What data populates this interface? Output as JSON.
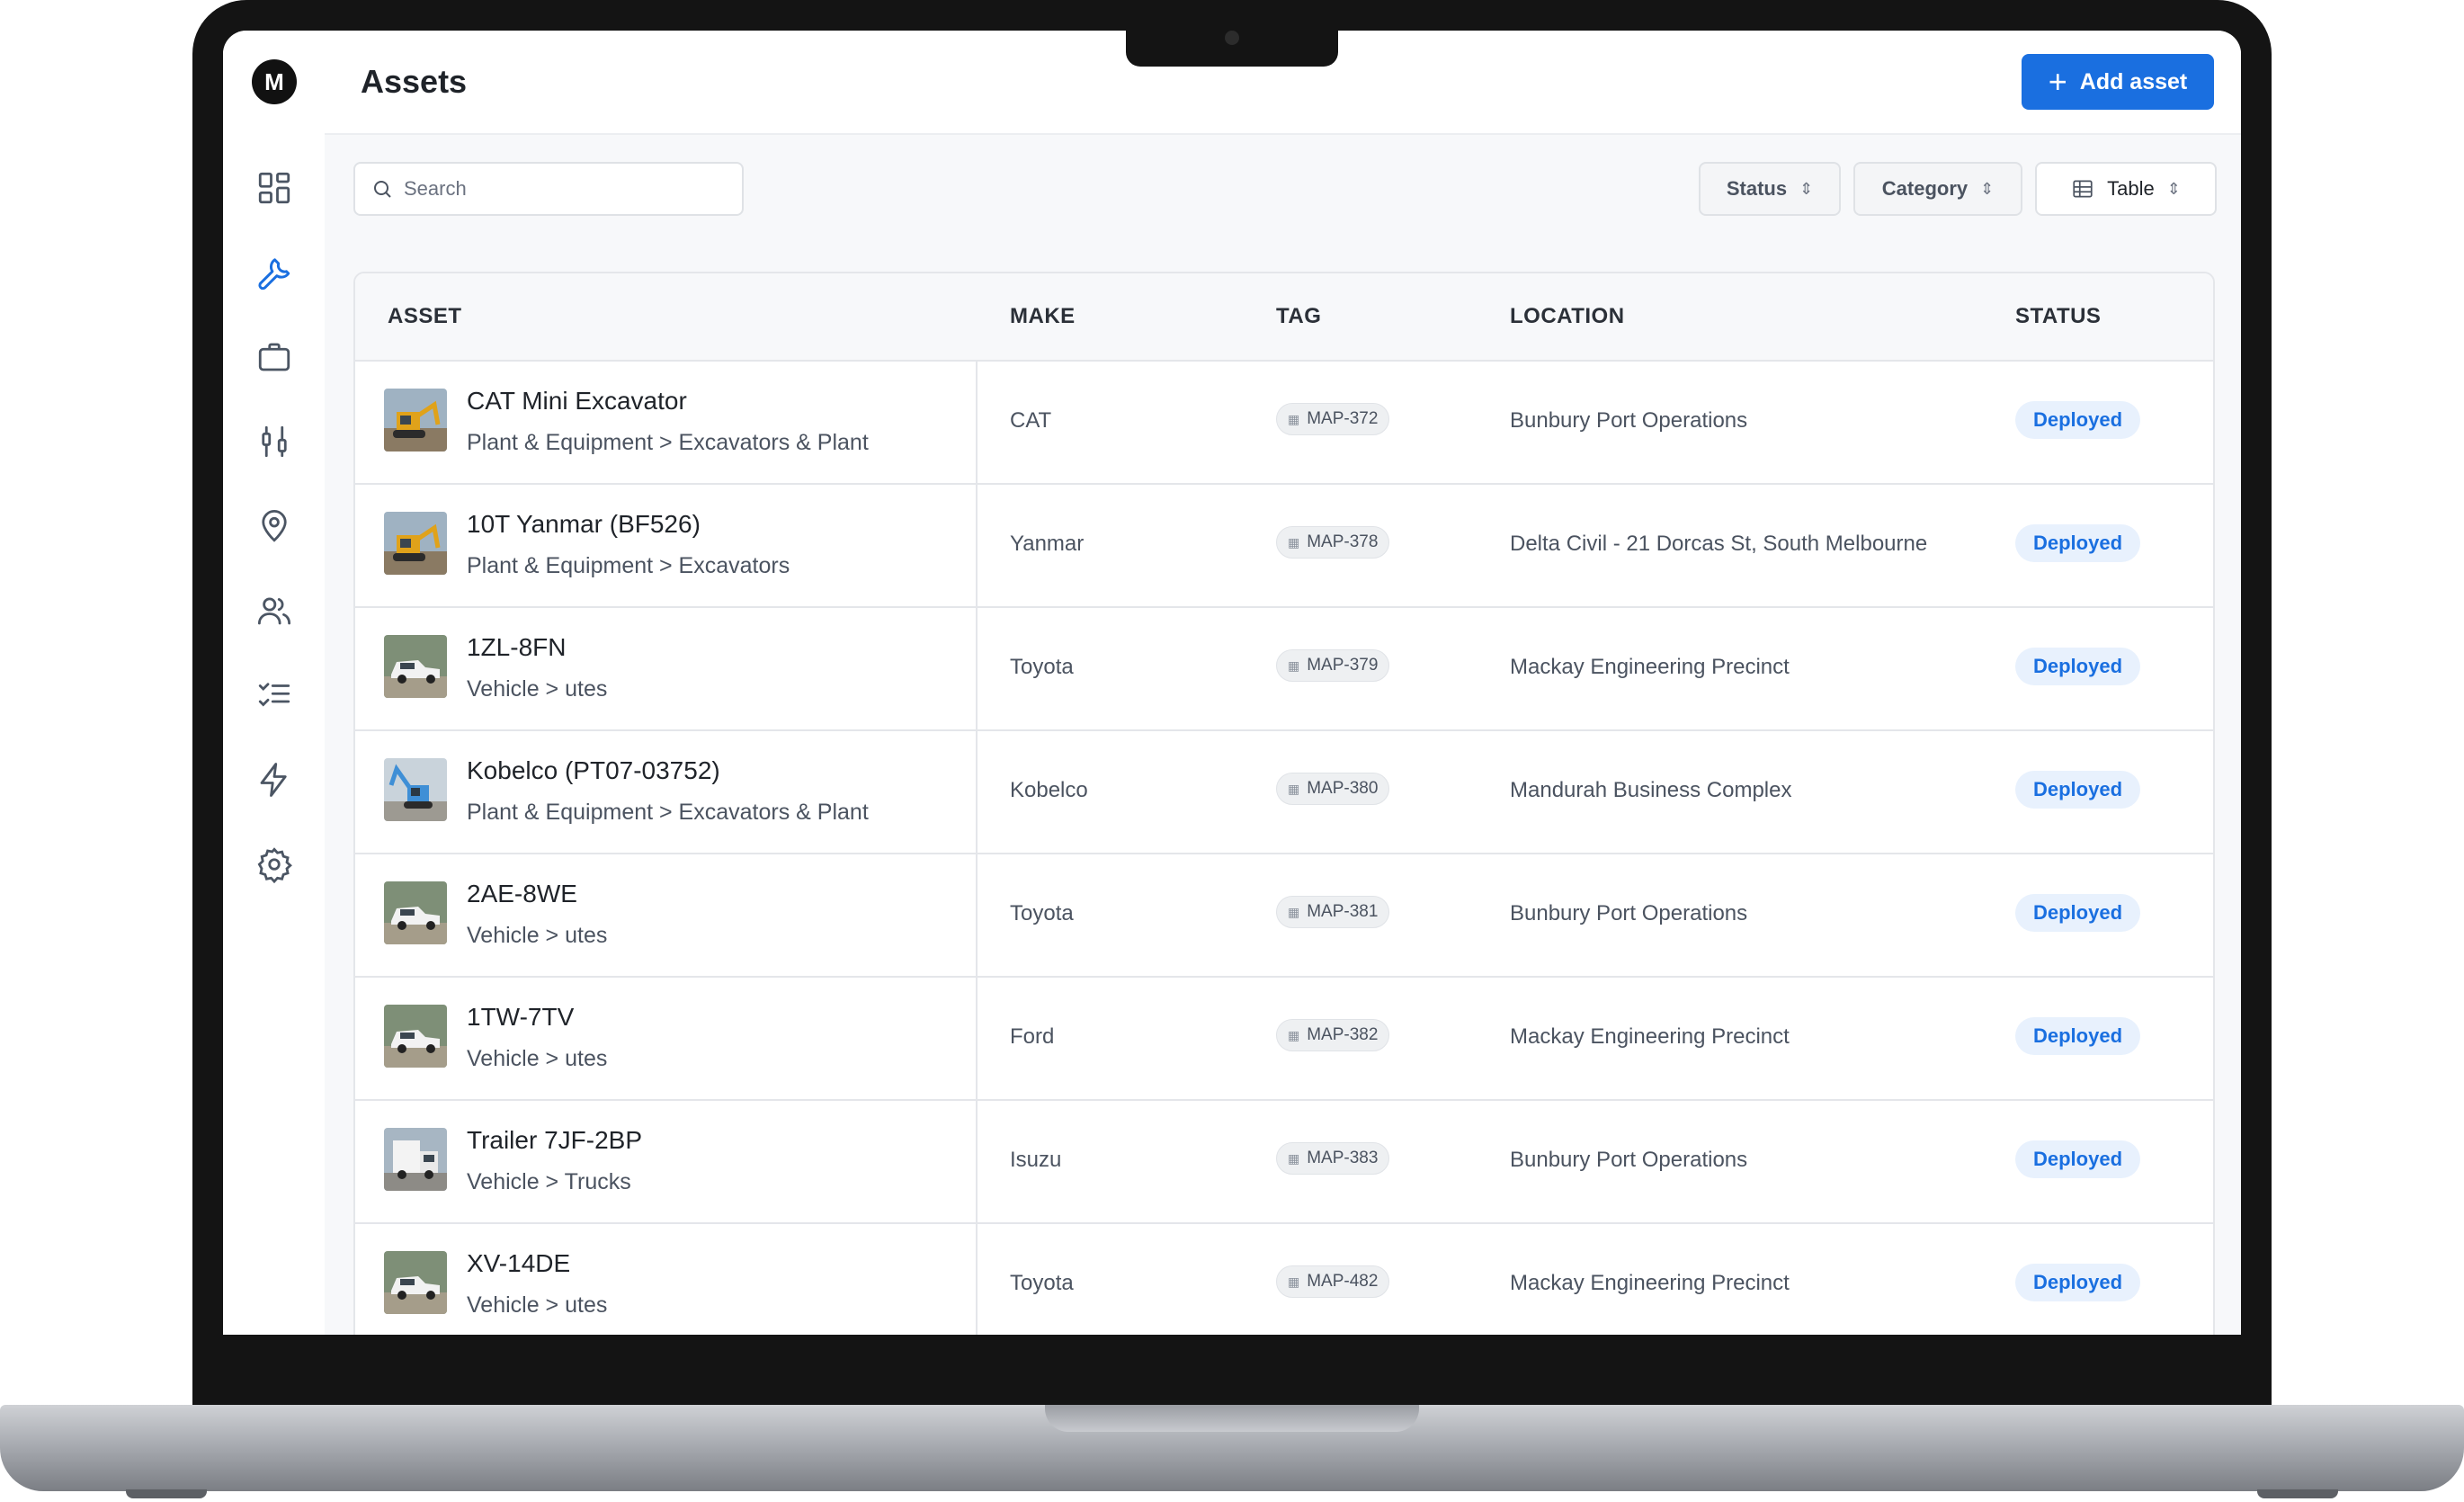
{
  "app": {
    "title": "Assets",
    "logo_text": "M"
  },
  "toolbar": {
    "add_label": "Add asset"
  },
  "search": {
    "placeholder": "Search"
  },
  "filters": {
    "status": "Status",
    "category": "Category",
    "view": "Table"
  },
  "table": {
    "headers": {
      "asset": "ASSET",
      "make": "MAKE",
      "tag": "TAG",
      "location": "LOCATION",
      "status": "STATUS"
    },
    "rows": [
      {
        "name": "CAT Mini Excavator",
        "category": "Plant & Equipment > Excavators & Plant",
        "make": "CAT",
        "tag": "MAP-372",
        "location": "Bunbury Port Operations",
        "status": "Deployed",
        "thumb": "excavator-yellow"
      },
      {
        "name": "10T Yanmar (BF526)",
        "category": "Plant & Equipment > Excavators",
        "make": "Yanmar",
        "tag": "MAP-378",
        "location": "Delta Civil - 21 Dorcas St, South Melbourne",
        "status": "Deployed",
        "thumb": "excavator-yellow"
      },
      {
        "name": "1ZL-8FN",
        "category": "Vehicle > utes",
        "make": "Toyota",
        "tag": "MAP-379",
        "location": "Mackay Engineering Precinct",
        "status": "Deployed",
        "thumb": "ute-white"
      },
      {
        "name": "Kobelco (PT07-03752)",
        "category": "Plant & Equipment > Excavators & Plant",
        "make": "Kobelco",
        "tag": "MAP-380",
        "location": "Mandurah Business Complex",
        "status": "Deployed",
        "thumb": "excavator-blue"
      },
      {
        "name": "2AE-8WE",
        "category": "Vehicle > utes",
        "make": "Toyota",
        "tag": "MAP-381",
        "location": "Bunbury Port Operations",
        "status": "Deployed",
        "thumb": "ute-white"
      },
      {
        "name": "1TW-7TV",
        "category": "Vehicle > utes",
        "make": "Ford",
        "tag": "MAP-382",
        "location": "Mackay Engineering Precinct",
        "status": "Deployed",
        "thumb": "ute-white"
      },
      {
        "name": "Trailer 7JF-2BP",
        "category": "Vehicle > Trucks",
        "make": "Isuzu",
        "tag": "MAP-383",
        "location": "Bunbury Port Operations",
        "status": "Deployed",
        "thumb": "truck-white"
      },
      {
        "name": "XV-14DE",
        "category": "Vehicle > utes",
        "make": "Toyota",
        "tag": "MAP-482",
        "location": "Mackay Engineering Precinct",
        "status": "Deployed",
        "thumb": "ute-white"
      }
    ]
  },
  "colors": {
    "accent": "#1a6fe0",
    "status_bg": "#e8f1fd",
    "sidebar_active": "#1a6fe0"
  },
  "sidebar": {
    "icons": [
      "dashboard-icon",
      "wrench-icon",
      "briefcase-icon",
      "sliders-icon",
      "location-pin-icon",
      "users-icon",
      "checklist-icon",
      "lightning-icon",
      "gear-icon"
    ]
  }
}
